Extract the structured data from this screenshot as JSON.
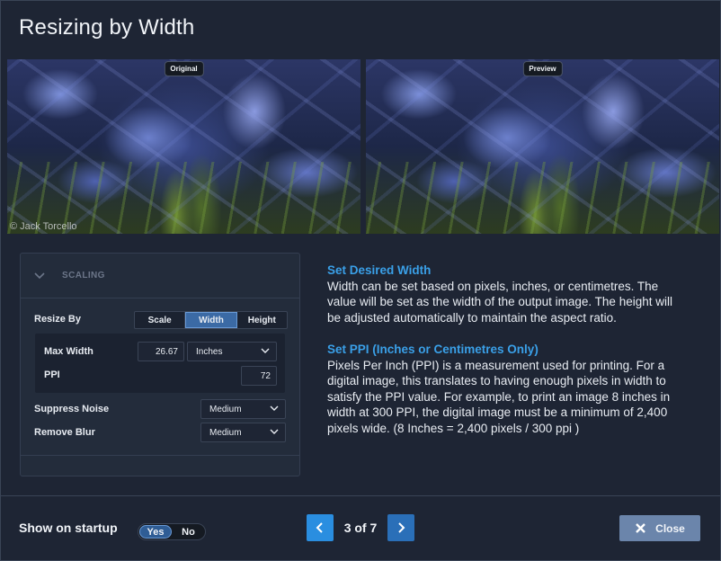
{
  "dialog": {
    "title": "Resizing by Width"
  },
  "images": {
    "original_label": "Original",
    "preview_label": "Preview",
    "credit": "© Jack Torcello"
  },
  "scaling": {
    "section_label": "SCALING",
    "resize_by_label": "Resize By",
    "resize_options": [
      "Scale",
      "Width",
      "Height"
    ],
    "resize_selected": "Width",
    "max_width_label": "Max Width",
    "max_width_value": "26.67",
    "unit_value": "Inches",
    "ppi_label": "PPI",
    "ppi_value": "72",
    "suppress_noise_label": "Suppress Noise",
    "suppress_noise_value": "Medium",
    "remove_blur_label": "Remove Blur",
    "remove_blur_value": "Medium"
  },
  "info": {
    "heading1": "Set Desired Width",
    "body1": "Width can be set based on pixels, inches, or centimetres. The value will be set as the width of the output image. The height will be adjusted automatically to maintain the aspect ratio.",
    "heading2": "Set PPI (Inches or Centimetres Only)",
    "body2": "Pixels Per Inch (PPI) is a measurement used for printing. For a digital image, this translates to having enough pixels in width to satisfy the PPI value. For example, to print an image 8 inches in width at 300 PPI, the digital image must be a minimum of 2,400 pixels wide. (8 Inches = 2,400 pixels / 300 ppi )"
  },
  "footer": {
    "startup_label": "Show on startup",
    "toggle_yes": "Yes",
    "toggle_no": "No",
    "pager": "3 of 7",
    "close_label": "Close"
  },
  "colors": {
    "accent": "#2a8ee0",
    "heading_blue": "#3aa0e8",
    "close_button": "#6b85ab",
    "background": "#1e2534"
  },
  "icons": {
    "collapse": "chevron-down-icon",
    "prev": "chevron-left-icon",
    "next": "chevron-right-icon",
    "close": "x-icon",
    "dropdown": "chevron-down-icon"
  }
}
